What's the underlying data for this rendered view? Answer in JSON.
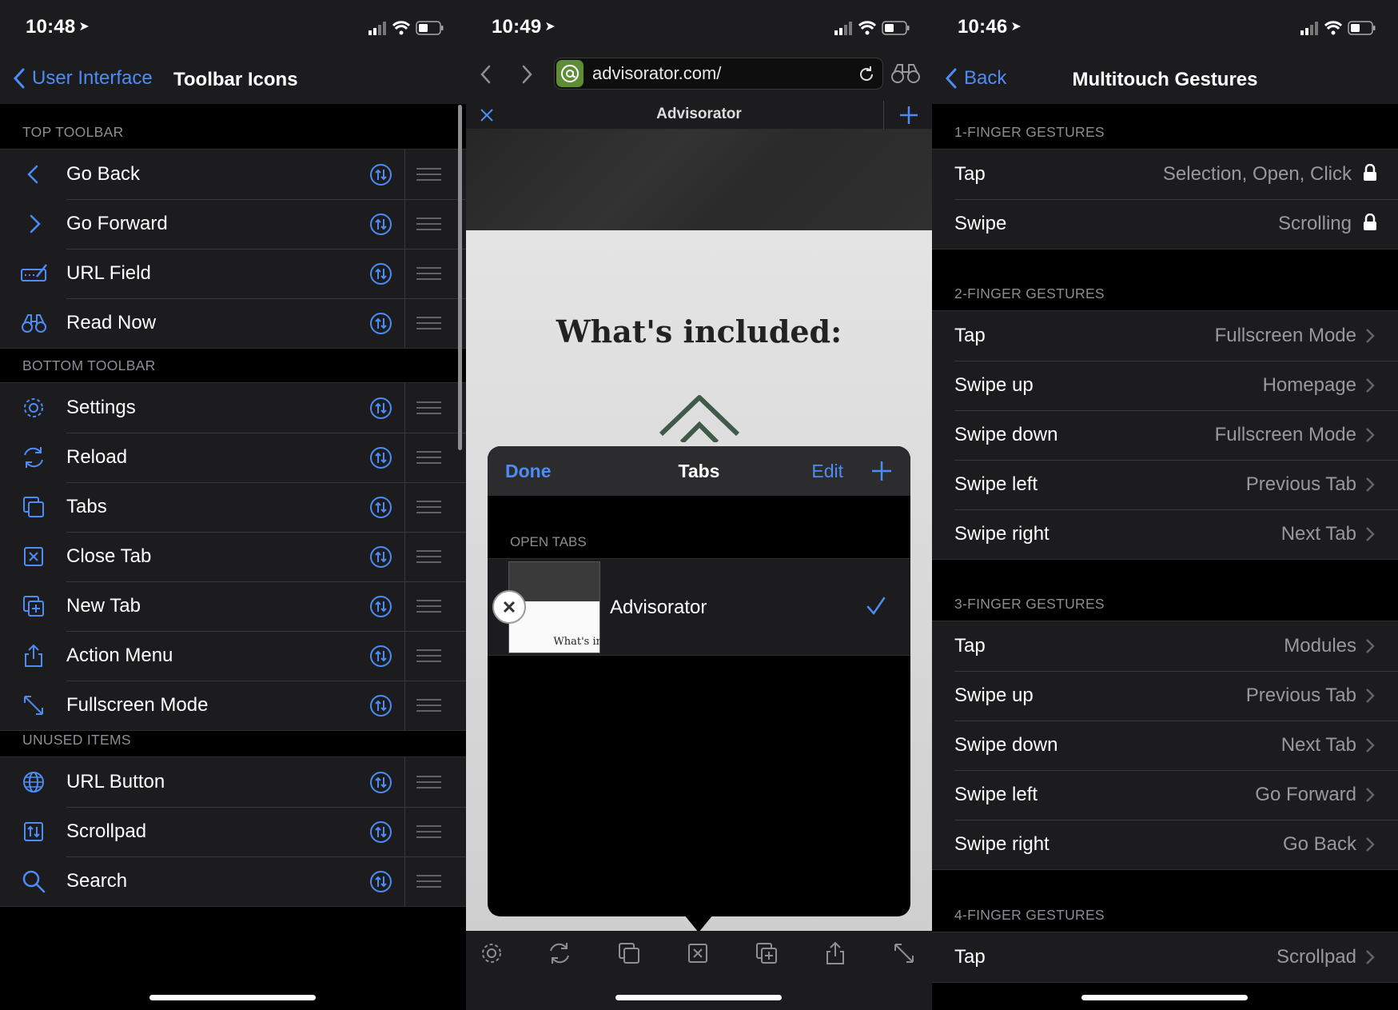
{
  "left": {
    "status_time": "10:48",
    "back_label": "User Interface",
    "title": "Toolbar Icons",
    "sections": [
      {
        "header": "TOP TOOLBAR",
        "items": [
          {
            "label": "Go Back",
            "icon": "chevron-left-icon"
          },
          {
            "label": "Go Forward",
            "icon": "chevron-right-icon"
          },
          {
            "label": "URL Field",
            "icon": "url-field-icon"
          },
          {
            "label": "Read Now",
            "icon": "binoculars-icon"
          }
        ]
      },
      {
        "header": "BOTTOM TOOLBAR",
        "items": [
          {
            "label": "Settings",
            "icon": "gear-icon"
          },
          {
            "label": "Reload",
            "icon": "reload-icon"
          },
          {
            "label": "Tabs",
            "icon": "tabs-icon"
          },
          {
            "label": "Close Tab",
            "icon": "close-tab-icon"
          },
          {
            "label": "New Tab",
            "icon": "new-tab-icon"
          },
          {
            "label": "Action Menu",
            "icon": "share-icon"
          },
          {
            "label": "Fullscreen Mode",
            "icon": "fullscreen-icon"
          }
        ]
      },
      {
        "header": "UNUSED ITEMS",
        "items": [
          {
            "label": "URL Button",
            "icon": "globe-icon"
          },
          {
            "label": "Scrollpad",
            "icon": "scrollpad-icon"
          },
          {
            "label": "Search",
            "icon": "search-icon"
          }
        ]
      }
    ]
  },
  "middle": {
    "status_time": "10:49",
    "url": "advisorator.com/",
    "tab_title": "Advisorator",
    "page_heading": "What's included:",
    "popover": {
      "done_label": "Done",
      "title": "Tabs",
      "edit_label": "Edit",
      "section": "OPEN TABS",
      "tab_name": "Advisorator",
      "thumb_text": "What's in"
    }
  },
  "right": {
    "status_time": "10:46",
    "back_label": "Back",
    "title": "Multitouch Gestures",
    "sections": [
      {
        "header": "1-FINGER GESTURES",
        "rows": [
          {
            "label": "Tap",
            "value": "Selection, Open, Click",
            "locked": true
          },
          {
            "label": "Swipe",
            "value": "Scrolling",
            "locked": true
          }
        ]
      },
      {
        "header": "2-FINGER GESTURES",
        "rows": [
          {
            "label": "Tap",
            "value": "Fullscreen Mode"
          },
          {
            "label": "Swipe up",
            "value": "Homepage"
          },
          {
            "label": "Swipe down",
            "value": "Fullscreen Mode"
          },
          {
            "label": "Swipe left",
            "value": "Previous Tab"
          },
          {
            "label": "Swipe right",
            "value": "Next Tab"
          }
        ]
      },
      {
        "header": "3-FINGER GESTURES",
        "rows": [
          {
            "label": "Tap",
            "value": "Modules"
          },
          {
            "label": "Swipe up",
            "value": "Previous Tab"
          },
          {
            "label": "Swipe down",
            "value": "Next Tab"
          },
          {
            "label": "Swipe left",
            "value": "Go Forward"
          },
          {
            "label": "Swipe right",
            "value": "Go Back"
          }
        ]
      },
      {
        "header": "4-FINGER GESTURES",
        "rows": [
          {
            "label": "Tap",
            "value": "Scrollpad"
          }
        ]
      }
    ]
  },
  "colors": {
    "accent": "#4d8cf5",
    "background": "#000000",
    "cell": "#1c1c1e",
    "secondary_text": "#98989e"
  }
}
